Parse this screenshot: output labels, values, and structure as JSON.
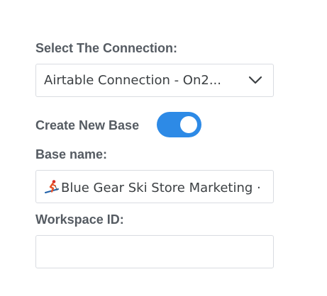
{
  "connection": {
    "label": "Select The Connection:",
    "selected_value": "Airtable Connection - On2...",
    "dropdown_icon": "chevron-down-icon"
  },
  "create_base": {
    "label": "Create New Base",
    "enabled": true,
    "toggle_color": "#2d8ae6"
  },
  "base_name": {
    "label": "Base name:",
    "emoji_icon": "skier-icon",
    "value": "Blue Gear Ski Store Marketing ·"
  },
  "workspace": {
    "label": "Workspace ID:",
    "value": ""
  },
  "colors": {
    "label_text": "#555b62",
    "field_border": "#d9dce1",
    "accent": "#2d8ae6"
  }
}
